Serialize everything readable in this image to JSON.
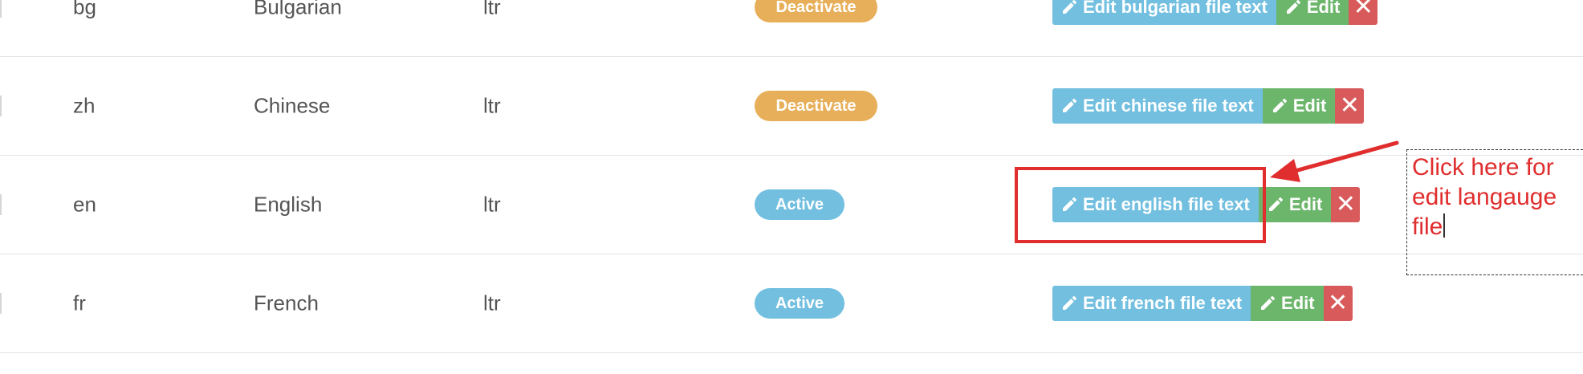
{
  "colors": {
    "warning": "#e8af5a",
    "info": "#72bfe0",
    "success": "#6cb66b",
    "danger": "#d85a5a",
    "annotation": "#e02d2d"
  },
  "rows": [
    {
      "code": "bg",
      "name": "Bulgarian",
      "direction": "ltr",
      "status": "Deactivate",
      "status_type": "warning",
      "file_btn": "Edit bulgarian file text",
      "edit_btn": "Edit",
      "delete_btn": "✕"
    },
    {
      "code": "zh",
      "name": "Chinese",
      "direction": "ltr",
      "status": "Deactivate",
      "status_type": "warning",
      "file_btn": "Edit chinese file text",
      "edit_btn": "Edit",
      "delete_btn": "✕"
    },
    {
      "code": "en",
      "name": "English",
      "direction": "ltr",
      "status": "Active",
      "status_type": "info",
      "file_btn": "Edit english file text",
      "edit_btn": "Edit",
      "delete_btn": "✕"
    },
    {
      "code": "fr",
      "name": "French",
      "direction": "ltr",
      "status": "Active",
      "status_type": "info",
      "file_btn": "Edit french file text",
      "edit_btn": "Edit",
      "delete_btn": "✕"
    }
  ],
  "annotation": {
    "lines": [
      "Click here for",
      "edit langauge",
      "file"
    ]
  },
  "icons": {
    "pencil": "pencil-icon",
    "delete": "close-icon",
    "arrow": "arrow-icon"
  }
}
